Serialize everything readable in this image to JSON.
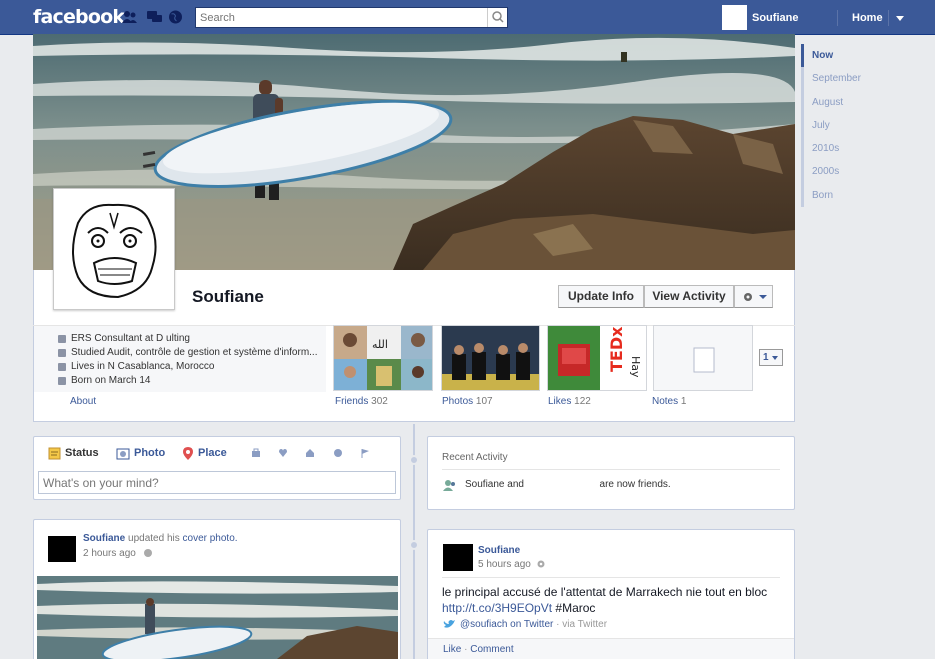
{
  "topbar": {
    "logo": "facebook",
    "search_placeholder": "Search",
    "user_name": "Soufiane",
    "home_label": "Home"
  },
  "profile": {
    "name": "Soufiane",
    "update_info": "Update Info",
    "view_activity": "View Activity"
  },
  "about": {
    "items": [
      "ERS Consultant at D            ulting",
      "Studied Audit, contrôle de gestion et système d'inform...",
      "Lives in N           Casablanca, Morocco",
      "Born on March 14"
    ],
    "link": "About"
  },
  "tiles": {
    "friends": {
      "label": "Friends",
      "count": "302"
    },
    "photos": {
      "label": "Photos",
      "count": "107"
    },
    "likes": {
      "label": "Likes",
      "count": "122"
    },
    "notes": {
      "label": "Notes",
      "count": "1"
    },
    "more": "1"
  },
  "timeline": [
    "Now",
    "September",
    "August",
    "July",
    "2010s",
    "2000s",
    "Born"
  ],
  "composer": {
    "tabs": [
      "Status",
      "Photo",
      "Place"
    ],
    "placeholder": "What's on your mind?"
  },
  "recent_activity": {
    "title": "Recent Activity",
    "text_pre": "Soufiane and",
    "text_post": "are now friends."
  },
  "post_left": {
    "author": "Soufiane",
    "action_pre": "updated his",
    "action_link": "cover photo.",
    "time": "2 hours ago"
  },
  "post_right": {
    "author": "Soufiane",
    "time": "5 hours ago",
    "text": "le principal accusé de l'attentat de Marrakech nie tout en bloc",
    "link": "http://t.co/3H9EOpVt",
    "hashtag": "#Maroc",
    "via_handle": "@soufiach on Twitter",
    "via_suffix": "· via Twitter",
    "actions": [
      "Like",
      "Comment"
    ]
  },
  "colors": {
    "brand": "#3b5998",
    "page_bg": "#e9ebee"
  }
}
